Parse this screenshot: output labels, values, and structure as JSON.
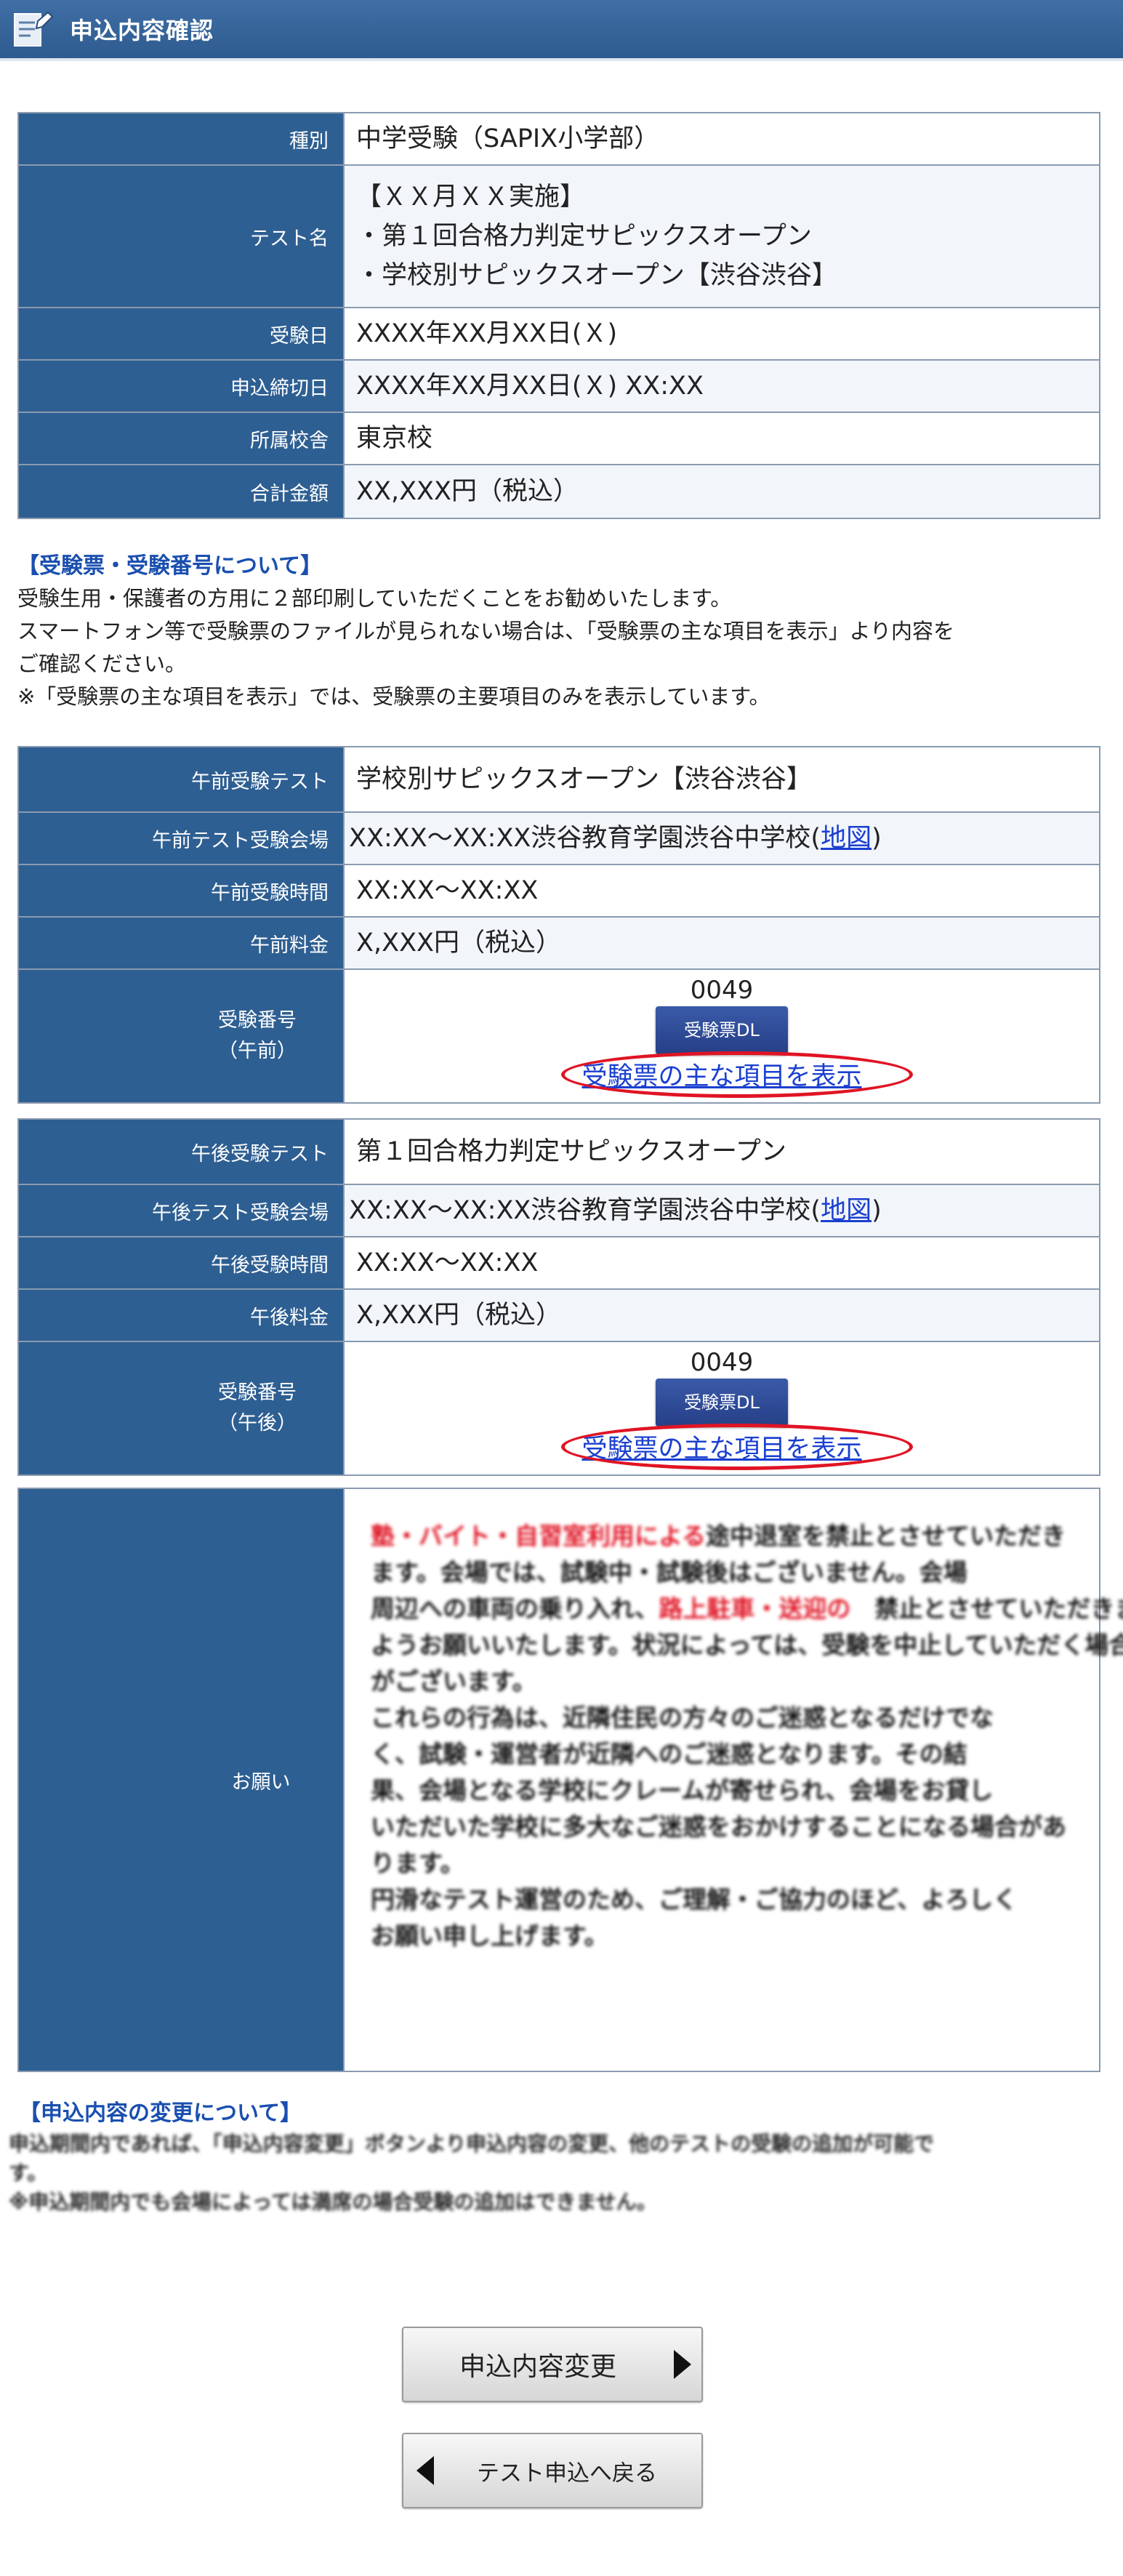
{
  "header": {
    "title": "申込内容確認"
  },
  "summary": {
    "rows": [
      {
        "label": "種別",
        "value": "中学受験（SAPIX小学部）"
      },
      {
        "label": "テスト名",
        "lines": [
          "【ＸＸ月ＸＸ実施】",
          "・第１回合格力判定サピックスオープン",
          "・学校別サピックスオープン【渋谷渋谷】"
        ]
      },
      {
        "label": "受験日",
        "value": "XXXX年XX月XX日(Ｘ)"
      },
      {
        "label": "申込締切日",
        "value": "XXXX年XX月XX日(Ｘ) XX:XX"
      },
      {
        "label": "所属校舎",
        "value": "東京校"
      },
      {
        "label": "合計金額",
        "value": "XX,XXX円（税込）"
      }
    ]
  },
  "ticket_note": {
    "heading": "【受験票・受験番号について】",
    "lines": [
      "受験生用・保護者の方用に２部印刷していただくことをお勧めいたします。",
      "スマートフォン等で受験票のファイルが見られない場合は、「受験票の主な項目を表示」より内容を",
      "ご確認ください。",
      "※「受験票の主な項目を表示」では、受験票の主要項目のみを表示しています。"
    ]
  },
  "morning": {
    "test_label": "午前受験テスト",
    "test_value": "学校別サピックスオープン【渋谷渋谷】",
    "venue_label": "午前テスト受験会場",
    "venue_value": "XX:XX～XX:XX渋谷教育学園渋谷中学校(",
    "venue_map": "地図",
    "venue_close": ")",
    "time_label": "午前受験時間",
    "time_value": "XX:XX～XX:XX",
    "fee_label": "午前料金",
    "fee_value": "X,XXX円（税込）",
    "number_label_1": "受験番号",
    "number_label_2": "（午前）",
    "number": "0049",
    "dl_button": "受験票DL",
    "detail_link": "受験票の主な項目を表示"
  },
  "afternoon": {
    "test_label": "午後受験テスト",
    "test_value": "第１回合格力判定サピックスオープン",
    "venue_label": "午後テスト受験会場",
    "venue_value": "XX:XX～XX:XX渋谷教育学園渋谷中学校(",
    "venue_map": "地図",
    "venue_close": ")",
    "time_label": "午後受験時間",
    "time_value": "XX:XX～XX:XX",
    "fee_label": "午後料金",
    "fee_value": "X,XXX円（税込）",
    "number_label_1": "受験番号",
    "number_label_2": "（午後）",
    "number": "0049",
    "dl_button": "受験票DL",
    "detail_link": "受験票の主な項目を表示"
  },
  "request": {
    "label": "お願い",
    "lines": [
      {
        "red": "塾・バイト・自習室利用による",
        "text": "途中退室を禁止とさせていただき"
      },
      {
        "red": "",
        "text": "ます。会場では、試験中・試験後はございません。会場"
      },
      {
        "red": "",
        "text": "周辺への車両の乗り入れ、",
        "red2": "路上駐車・送迎の",
        "text2": "　禁止とさせていただきます"
      },
      {
        "red": "",
        "text": "ようお願いいたします。状況によっては、受験を中止していただく場合"
      },
      {
        "red": "",
        "text": "がございます。"
      },
      {
        "red": "",
        "text": "これらの行為は、近隣住民の方々のご迷惑となるだけでな"
      },
      {
        "red": "",
        "text": "く、試験・運営者が近隣へのご迷惑となります。その結"
      },
      {
        "red": "",
        "text": "果、会場となる学校にクレームが寄せられ、会場をお貸し"
      },
      {
        "red": "",
        "text": "いただいた学校に多大なご迷惑をおかけすることになる場合があ"
      },
      {
        "red": "",
        "text": "ります。"
      },
      {
        "red": "",
        "text": "円滑なテスト運営のため、ご理解・ご協力のほど、よろしく"
      },
      {
        "red": "",
        "text": "お願い申し上げます。"
      }
    ]
  },
  "change_note": {
    "heading": "【申込内容の変更について】",
    "lines": [
      "申込期間内であれば、「申込内容変更」ボタンより申込内容の変更、他のテストの受験の追加が可能で",
      "す。",
      "※申込期間内でも会場によっては満席の場合受験の追加はできません。"
    ]
  },
  "buttons": {
    "change": "申込内容変更",
    "back": "テスト申込へ戻る"
  }
}
